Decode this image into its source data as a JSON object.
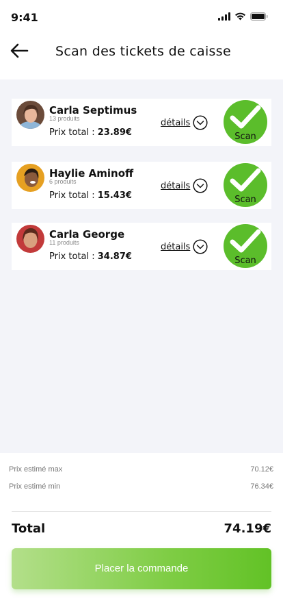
{
  "status_bar": {
    "time": "9:41"
  },
  "header": {
    "title": "Scan des tickets de caisse"
  },
  "customers": [
    {
      "name": "Carla Septimus",
      "products": "13 produits",
      "price_label": "Prix total : ",
      "price": "23.89€",
      "details": "détails",
      "scan": "Scan"
    },
    {
      "name": "Haylie Aminoff",
      "products": "6 produits",
      "price_label": "Prix total : ",
      "price": "15.43€",
      "details": "détails",
      "scan": "Scan"
    },
    {
      "name": "Carla George",
      "products": "11 produits",
      "price_label": "Prix total : ",
      "price": "34.87€",
      "details": "détails",
      "scan": "Scan"
    }
  ],
  "estimates": {
    "max_label": "Prix estimé max",
    "max_value": "70.12€",
    "min_label": "Prix estimé min",
    "min_value": "76.34€"
  },
  "total": {
    "label": "Total",
    "value": "74.19€"
  },
  "order_button": {
    "label": "Placer la commande"
  },
  "colors": {
    "accent": "#5bbd2b",
    "background": "#f3f4f9"
  }
}
